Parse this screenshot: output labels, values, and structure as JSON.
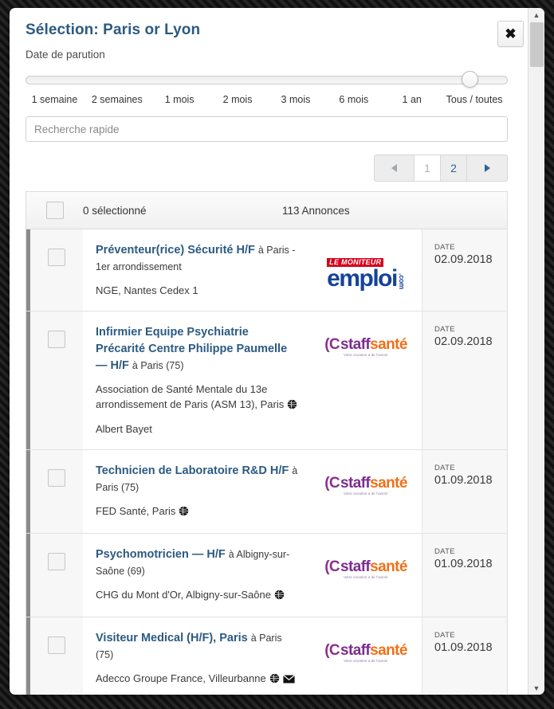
{
  "modal": {
    "title": "Sélection: Paris or Lyon",
    "subtitle": "Date de parution",
    "close_label": "✖"
  },
  "slider": {
    "selected": "Tous / toutes",
    "handle_percent": 92,
    "options": [
      "1 semaine",
      "2 semaines",
      "1 mois",
      "2 mois",
      "3 mois",
      "6 mois",
      "1 an",
      "Tous / toutes"
    ]
  },
  "search": {
    "placeholder": "Recherche rapide",
    "value": ""
  },
  "pagination": {
    "prev_label": "",
    "next_label": "",
    "pages": [
      "1",
      "2"
    ],
    "current": "1"
  },
  "list_header": {
    "selected_text": "0 sélectionné",
    "count_text": "113 Annonces"
  },
  "rows": [
    {
      "title": "Préventeur(rice) Sécurité H/F",
      "location": "à Paris - 1er arrondissement",
      "company": "NGE, Nantes Cedex 1",
      "extra": "",
      "icons": [],
      "logo": "le-moniteur-emploi",
      "date_label": "DATE",
      "date_value": "02.09.2018"
    },
    {
      "title": "Infirmier Equipe Psychiatrie Précarité Centre Philippe Paumelle — H/F",
      "location": "à Paris (75)",
      "company": "Association de Santé Mentale du 13e arrondissement de Paris (ASM 13), Paris",
      "extra": "Albert Bayet",
      "icons": [
        "globe"
      ],
      "logo": "staffsante",
      "date_label": "DATE",
      "date_value": "02.09.2018"
    },
    {
      "title": "Technicien de Laboratoire R&D H/F",
      "location": "à Paris (75)",
      "company": "FED Santé, Paris",
      "extra": "",
      "icons": [
        "globe"
      ],
      "logo": "staffsante",
      "date_label": "DATE",
      "date_value": "01.09.2018"
    },
    {
      "title": "Psychomotricien — H/F",
      "location": "à Albigny-sur-Saône (69)",
      "company": "CHG du Mont d'Or, Albigny-sur-Saône",
      "extra": "",
      "icons": [
        "globe"
      ],
      "logo": "staffsante",
      "date_label": "DATE",
      "date_value": "01.09.2018"
    },
    {
      "title": "Visiteur Medical (H/F), Paris",
      "location": "à Paris (75)",
      "company": "Adecco Groupe France, Villeurbanne",
      "extra": "",
      "icons": [
        "globe",
        "envelope"
      ],
      "logo": "staffsante",
      "date_label": "DATE",
      "date_value": "01.09.2018"
    }
  ],
  "logos": {
    "staffsante": {
      "mark": "(C",
      "part1": "staff",
      "part2": "santé",
      "tagline": "Votre vocation a de l'avenir"
    },
    "le_moniteur_emploi": {
      "band": "LE MONITEUR",
      "word": "emploi",
      "tld": ".com"
    }
  },
  "scrollbar": {
    "up": "▲",
    "down": "▼"
  },
  "colors": {
    "title_blue": "#2c5a82",
    "link_blue": "#2c5a82",
    "staff_purple": "#7b2d8e",
    "sante_orange": "#f07018",
    "moniteur_red": "#d6001c",
    "emploi_blue": "#15439b"
  }
}
